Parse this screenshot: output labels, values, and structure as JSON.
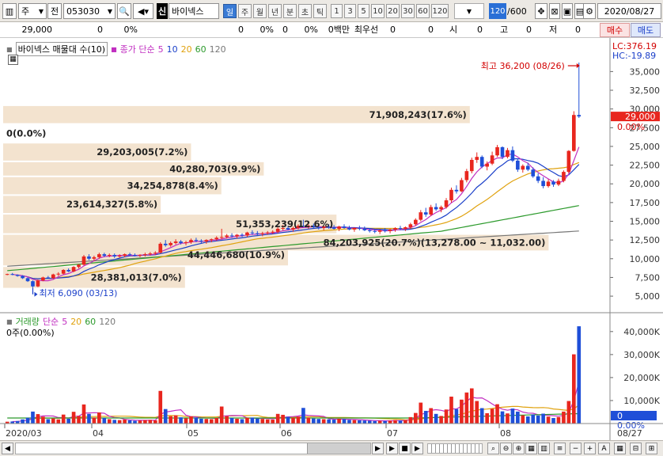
{
  "toolbar": {
    "period_label": "주",
    "market_label": "전",
    "stock_code": "053030",
    "sin_badge": "신",
    "stock_name": "바이넥스",
    "period_buttons": [
      "일",
      "주",
      "월",
      "년",
      "분",
      "초",
      "틱"
    ],
    "active_period": "일",
    "interval_buttons": [
      "1",
      "3",
      "5",
      "10",
      "20",
      "30",
      "60",
      "120"
    ],
    "count_value": "120",
    "count_total": "/600",
    "date_value": "2020/08/27"
  },
  "infobar": {
    "price": "29,000",
    "change1": "0",
    "pct1": "0%",
    "change2": "0",
    "pct2": "0%",
    "vol1": "0",
    "pct3": "0%",
    "amount": "0백만",
    "priority_label": "최우선",
    "p1": "0",
    "p2": "0",
    "open_label": "시",
    "open_val": "0",
    "high_label": "고",
    "high_val": "0",
    "low_label": "저",
    "low_val": "0",
    "buy_btn": "매수",
    "sell_btn": "매도"
  },
  "chart_data": {
    "type": "candlestick",
    "legend_price": {
      "name": "바이넥스 매물대 수(10)",
      "ma_label": "종가 단순",
      "ma": [
        "5",
        "10",
        "20",
        "60",
        "120"
      ]
    },
    "legend_volume": {
      "name": "거래량",
      "ma_label": "단순",
      "ma": [
        "5",
        "20",
        "60",
        "120"
      ],
      "zero_label": "0주(0.00%)"
    },
    "colors": {
      "up": "#e8261e",
      "down": "#1f4fd8",
      "ma5": "#c12fc1",
      "ma10": "#1a3fc9",
      "ma20": "#e0a20e",
      "ma60": "#2c9a2c",
      "ma120": "#777777",
      "band": "#f3e3cf"
    },
    "y_axis": {
      "ticks": [
        "35,000",
        "32,500",
        "30,000",
        "27,500",
        "25,000",
        "22,500",
        "20,000",
        "17,500",
        "15,000",
        "12,500",
        "10,000",
        "7,500",
        "5,000"
      ],
      "min": 3000,
      "max": 38000
    },
    "y_axis_top": {
      "lc": "LC:376.19",
      "hc": "HC:-19.89"
    },
    "price_tag": "29,000",
    "pct_tag": "0.00%",
    "vol_axis": {
      "ticks": [
        "40,000K",
        "30,000K",
        "20,000K",
        "10,000K",
        "0"
      ],
      "max": 42000
    },
    "vol_tags": {
      "zero": "0",
      "pct": "0.00%"
    },
    "x_labels": [
      "2020/03",
      "04",
      "05",
      "06",
      "07",
      "08"
    ],
    "x_right_label": "08/27",
    "max_label": "최고 36,200 (08/26)",
    "min_label": "최저 6,090 (03/13)",
    "volume_profile": [
      {
        "label": "28,381,013(7.0%)",
        "price_lo": 6000,
        "price_hi": 9000,
        "width": 0.3
      },
      {
        "label": "44,446,680(10.9%)",
        "price_lo": 9000,
        "price_hi": 12000,
        "width": 0.47
      },
      {
        "label": "84,203,925(20.7%)(13,278.00 ~ 11,032.00)",
        "price_lo": 11000,
        "price_hi": 13300,
        "width": 0.9
      },
      {
        "label": "51,353,239(12.6%)",
        "price_lo": 13300,
        "price_hi": 16000,
        "width": 0.55
      },
      {
        "label": "23,614,327(5.8%)",
        "price_lo": 16000,
        "price_hi": 18500,
        "width": 0.26
      },
      {
        "label": "34,254,878(8.4%)",
        "price_lo": 18500,
        "price_hi": 21000,
        "width": 0.36
      },
      {
        "label": "40,280,703(9.9%)",
        "price_lo": 21000,
        "price_hi": 23000,
        "width": 0.43
      },
      {
        "label": "29,203,005(7.2%)",
        "price_lo": 23000,
        "price_hi": 25500,
        "width": 0.31
      },
      {
        "label": "0(0.0%)",
        "price_lo": 25500,
        "price_hi": 28000,
        "width": 0.0
      },
      {
        "label": "71,908,243(17.6%)",
        "price_lo": 28000,
        "price_hi": 30500,
        "width": 0.77
      }
    ],
    "candles": [
      [
        7900,
        8000,
        7800,
        7950,
        800
      ],
      [
        7950,
        8100,
        7800,
        7850,
        900
      ],
      [
        7850,
        7900,
        7600,
        7700,
        1100
      ],
      [
        7700,
        7800,
        7300,
        7400,
        1800
      ],
      [
        7400,
        7500,
        6900,
        7000,
        2500
      ],
      [
        7000,
        7100,
        6090,
        6300,
        5200
      ],
      [
        6300,
        7200,
        6200,
        7100,
        4100
      ],
      [
        7100,
        7600,
        7000,
        7500,
        3000
      ],
      [
        7500,
        7700,
        7300,
        7400,
        1900
      ],
      [
        7400,
        8000,
        7300,
        7900,
        2200
      ],
      [
        7900,
        8200,
        7700,
        8000,
        1800
      ],
      [
        8000,
        8600,
        7900,
        8500,
        3900
      ],
      [
        8500,
        8700,
        8200,
        8300,
        2100
      ],
      [
        8300,
        9000,
        8200,
        8900,
        5100
      ],
      [
        8900,
        9300,
        8700,
        9200,
        3300
      ],
      [
        9200,
        10500,
        9100,
        10300,
        8300
      ],
      [
        10300,
        10600,
        9800,
        10000,
        4200
      ],
      [
        10000,
        10400,
        9700,
        10200,
        2600
      ],
      [
        10200,
        10800,
        10000,
        10600,
        4800
      ],
      [
        10600,
        10800,
        10200,
        10400,
        2400
      ],
      [
        10400,
        10700,
        10200,
        10500,
        1900
      ],
      [
        10500,
        10700,
        10100,
        10300,
        1600
      ],
      [
        10300,
        10600,
        10100,
        10400,
        1500
      ],
      [
        10400,
        10700,
        10200,
        10600,
        1700
      ],
      [
        10600,
        10800,
        10300,
        10500,
        1400
      ],
      [
        10500,
        10700,
        10300,
        10400,
        1200
      ],
      [
        10400,
        10600,
        10200,
        10500,
        1300
      ],
      [
        10500,
        10800,
        10300,
        10600,
        1500
      ],
      [
        10600,
        10900,
        10400,
        10700,
        1600
      ],
      [
        10700,
        11000,
        10500,
        10800,
        1400
      ],
      [
        10800,
        12200,
        10700,
        12000,
        14200
      ],
      [
        12000,
        12500,
        11600,
        11800,
        6300
      ],
      [
        11800,
        12300,
        11600,
        12100,
        3200
      ],
      [
        12100,
        12600,
        11900,
        12300,
        3600
      ],
      [
        12300,
        12500,
        11900,
        12100,
        2700
      ],
      [
        12100,
        12400,
        11800,
        12200,
        2300
      ],
      [
        12200,
        12700,
        12000,
        12500,
        3100
      ],
      [
        12500,
        12800,
        12200,
        12400,
        2600
      ],
      [
        12400,
        12600,
        12100,
        12300,
        2100
      ],
      [
        12300,
        12600,
        12000,
        12500,
        2000
      ],
      [
        12500,
        12700,
        12200,
        12600,
        1900
      ],
      [
        12600,
        13000,
        12400,
        12800,
        2400
      ],
      [
        12800,
        14000,
        12600,
        12900,
        7400
      ],
      [
        12900,
        13300,
        12700,
        13100,
        3200
      ],
      [
        13100,
        13400,
        12800,
        13000,
        2400
      ],
      [
        13000,
        13300,
        12700,
        13200,
        2100
      ],
      [
        13200,
        13400,
        12900,
        13100,
        1900
      ],
      [
        13100,
        13600,
        12900,
        13500,
        2500
      ],
      [
        13500,
        13800,
        13200,
        13400,
        2600
      ],
      [
        13400,
        13700,
        13100,
        13300,
        2200
      ],
      [
        13300,
        13600,
        13000,
        13400,
        2000
      ],
      [
        13400,
        13700,
        13200,
        13500,
        1800
      ],
      [
        13500,
        13800,
        13300,
        13600,
        1700
      ],
      [
        13600,
        14200,
        13400,
        14000,
        4200
      ],
      [
        14000,
        14500,
        13800,
        14100,
        3800
      ],
      [
        14100,
        14400,
        13800,
        13900,
        2900
      ],
      [
        13900,
        14300,
        13600,
        14100,
        2500
      ],
      [
        14100,
        14600,
        13900,
        14400,
        3000
      ],
      [
        14400,
        15200,
        14200,
        14300,
        6800
      ],
      [
        14300,
        14600,
        14000,
        14400,
        2600
      ],
      [
        14400,
        14700,
        14100,
        14200,
        2200
      ],
      [
        14200,
        14500,
        13900,
        14100,
        2000
      ],
      [
        14100,
        14400,
        13800,
        14300,
        1900
      ],
      [
        14300,
        14600,
        14000,
        14200,
        1800
      ],
      [
        14200,
        14500,
        13900,
        14000,
        1700
      ],
      [
        14000,
        14400,
        13700,
        14300,
        2100
      ],
      [
        14300,
        14600,
        14000,
        14100,
        1900
      ],
      [
        14100,
        14400,
        13800,
        13900,
        1600
      ],
      [
        13900,
        14200,
        13600,
        14100,
        1500
      ],
      [
        14100,
        14400,
        13800,
        14000,
        1400
      ],
      [
        14000,
        14300,
        13700,
        13800,
        1300
      ],
      [
        13800,
        14100,
        13500,
        13700,
        1200
      ],
      [
        13700,
        14000,
        13400,
        13600,
        1100
      ],
      [
        13600,
        13900,
        13300,
        13800,
        1200
      ],
      [
        13800,
        14100,
        13500,
        13700,
        1100
      ],
      [
        13700,
        14000,
        13400,
        13900,
        1300
      ],
      [
        13900,
        14200,
        13600,
        14100,
        1500
      ],
      [
        14100,
        14400,
        13800,
        14000,
        1300
      ],
      [
        14000,
        14300,
        13700,
        14200,
        1400
      ],
      [
        14200,
        14800,
        14000,
        14600,
        2800
      ],
      [
        14600,
        15400,
        14400,
        15200,
        4600
      ],
      [
        15200,
        16500,
        15000,
        16200,
        9100
      ],
      [
        16200,
        16800,
        15600,
        15900,
        5500
      ],
      [
        15900,
        17200,
        15700,
        16900,
        6700
      ],
      [
        16900,
        17400,
        16400,
        16600,
        4200
      ],
      [
        16600,
        17100,
        16200,
        16900,
        3300
      ],
      [
        16900,
        18100,
        16700,
        17800,
        6100
      ],
      [
        17800,
        19500,
        17500,
        19200,
        11700
      ],
      [
        19200,
        19800,
        18700,
        19000,
        6300
      ],
      [
        19000,
        20800,
        18900,
        20500,
        10400
      ],
      [
        20500,
        22000,
        20200,
        21700,
        13500
      ],
      [
        21700,
        23500,
        21400,
        23200,
        15300
      ],
      [
        23200,
        24200,
        22800,
        23600,
        9800
      ],
      [
        23600,
        23800,
        22100,
        22300,
        6700
      ],
      [
        22300,
        23000,
        21800,
        22700,
        4500
      ],
      [
        22700,
        24300,
        22500,
        23800,
        6400
      ],
      [
        23800,
        25200,
        23600,
        24900,
        8400
      ],
      [
        24900,
        25000,
        23300,
        23600,
        5300
      ],
      [
        23600,
        24800,
        23400,
        24500,
        4400
      ],
      [
        24500,
        25000,
        22900,
        23100,
        6500
      ],
      [
        23100,
        23400,
        21600,
        21900,
        5200
      ],
      [
        21900,
        22600,
        21500,
        22400,
        3600
      ],
      [
        22400,
        22800,
        21700,
        21900,
        3100
      ],
      [
        21900,
        22200,
        20800,
        21000,
        3900
      ],
      [
        21000,
        21400,
        20100,
        20400,
        3500
      ],
      [
        20400,
        20900,
        19400,
        19700,
        4300
      ],
      [
        19700,
        20600,
        19500,
        20300,
        3000
      ],
      [
        20300,
        20500,
        19600,
        19900,
        2400
      ],
      [
        19900,
        20700,
        19700,
        20400,
        2800
      ],
      [
        20400,
        21800,
        20200,
        21600,
        5200
      ],
      [
        21600,
        24500,
        21400,
        24400,
        9800
      ],
      [
        24400,
        29700,
        24300,
        29200,
        30100
      ],
      [
        29200,
        36200,
        28800,
        29000,
        42300
      ]
    ]
  },
  "scrollbar": {
    "left": "◀",
    "right": "▶"
  }
}
